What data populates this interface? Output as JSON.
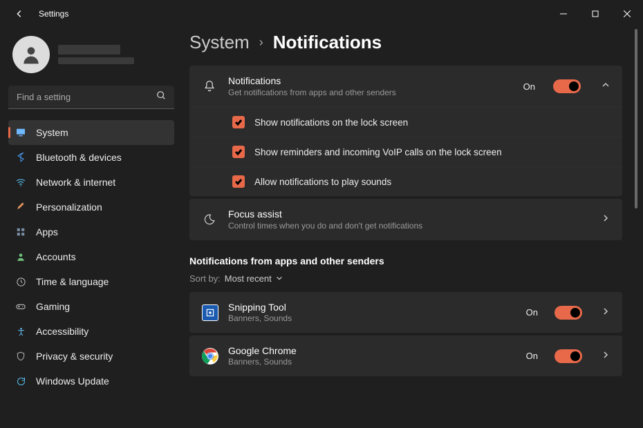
{
  "window": {
    "title": "Settings"
  },
  "search": {
    "placeholder": "Find a setting"
  },
  "nav": {
    "items": [
      {
        "label": "System",
        "icon": "monitor",
        "color": "#6fb8ff",
        "active": true
      },
      {
        "label": "Bluetooth & devices",
        "icon": "bluetooth",
        "color": "#4aa3ff"
      },
      {
        "label": "Network & internet",
        "icon": "wifi",
        "color": "#5ac8fa"
      },
      {
        "label": "Personalization",
        "icon": "brush",
        "color": "#e0935f"
      },
      {
        "label": "Apps",
        "icon": "grid",
        "color": "#7a8fa6"
      },
      {
        "label": "Accounts",
        "icon": "person",
        "color": "#6dbf7a"
      },
      {
        "label": "Time & language",
        "icon": "clock",
        "color": "#c0c0c0"
      },
      {
        "label": "Gaming",
        "icon": "gamepad",
        "color": "#c0c0c0"
      },
      {
        "label": "Accessibility",
        "icon": "acc",
        "color": "#66c7ff"
      },
      {
        "label": "Privacy & security",
        "icon": "shield",
        "color": "#c0c0c0"
      },
      {
        "label": "Windows Update",
        "icon": "update",
        "color": "#5ac8fa"
      }
    ]
  },
  "breadcrumb": {
    "parent": "System",
    "sep": "›",
    "current": "Notifications"
  },
  "notif_card": {
    "title": "Notifications",
    "sub": "Get notifications from apps and other senders",
    "state": "On",
    "checks": [
      {
        "label": "Show notifications on the lock screen"
      },
      {
        "label": "Show reminders and incoming VoIP calls on the lock screen"
      },
      {
        "label": "Allow notifications to play sounds"
      }
    ]
  },
  "focus_card": {
    "title": "Focus assist",
    "sub": "Control times when you do and don't get notifications"
  },
  "apps_section": {
    "title": "Notifications from apps and other senders",
    "sort_label": "Sort by:",
    "sort_value": "Most recent",
    "items": [
      {
        "name": "Snipping Tool",
        "sub": "Banners, Sounds",
        "state": "On",
        "icon": "snip"
      },
      {
        "name": "Google Chrome",
        "sub": "Banners, Sounds",
        "state": "On",
        "icon": "chrome"
      }
    ]
  }
}
